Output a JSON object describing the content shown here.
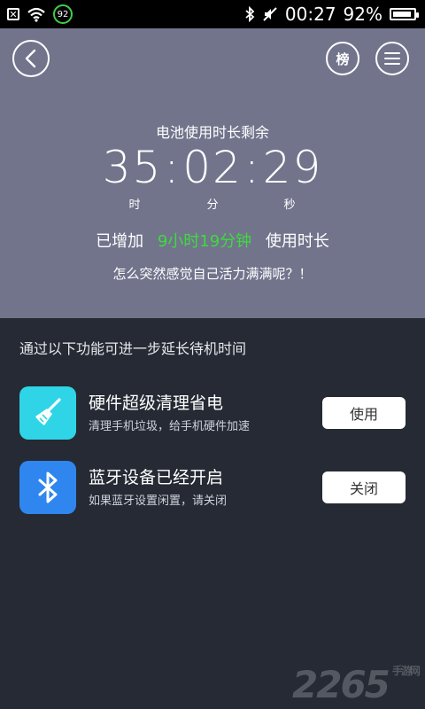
{
  "status_bar": {
    "notification_icon": "x-box-icon",
    "signal_badge": "92",
    "time": "00:27",
    "battery_percent": "92%",
    "battery_level": 0.92
  },
  "header": {
    "rank_label": "榜"
  },
  "hero": {
    "title": "电池使用时长剩余",
    "timer": {
      "hours": "35",
      "minutes": "02",
      "seconds": "29",
      "separator": ":"
    },
    "unit_hours": "时",
    "unit_minutes": "分",
    "unit_seconds": "秒",
    "added_prefix": "已增加",
    "added_value": "9小时19分钟",
    "added_suffix": "使用时长",
    "tip": "怎么突然感觉自己活力满满呢？！"
  },
  "section_title": "通过以下功能可进一步延长待机时间",
  "features": [
    {
      "icon": "broom-icon",
      "icon_color": "#2fd5e6",
      "title": "硬件超级清理省电",
      "desc": "清理手机垃圾，给手机硬件加速",
      "button": "使用"
    },
    {
      "icon": "bluetooth-icon",
      "icon_color": "#2f86ef",
      "title": "蓝牙设备已经开启",
      "desc": "如果蓝牙设置闲置，请关闭",
      "button": "关闭"
    }
  ],
  "watermark": {
    "main": "2265",
    "sub": "手游网"
  },
  "colors": {
    "hero_bg": "#72748c",
    "body_bg": "#252a34",
    "highlight": "#3ddb3d"
  }
}
